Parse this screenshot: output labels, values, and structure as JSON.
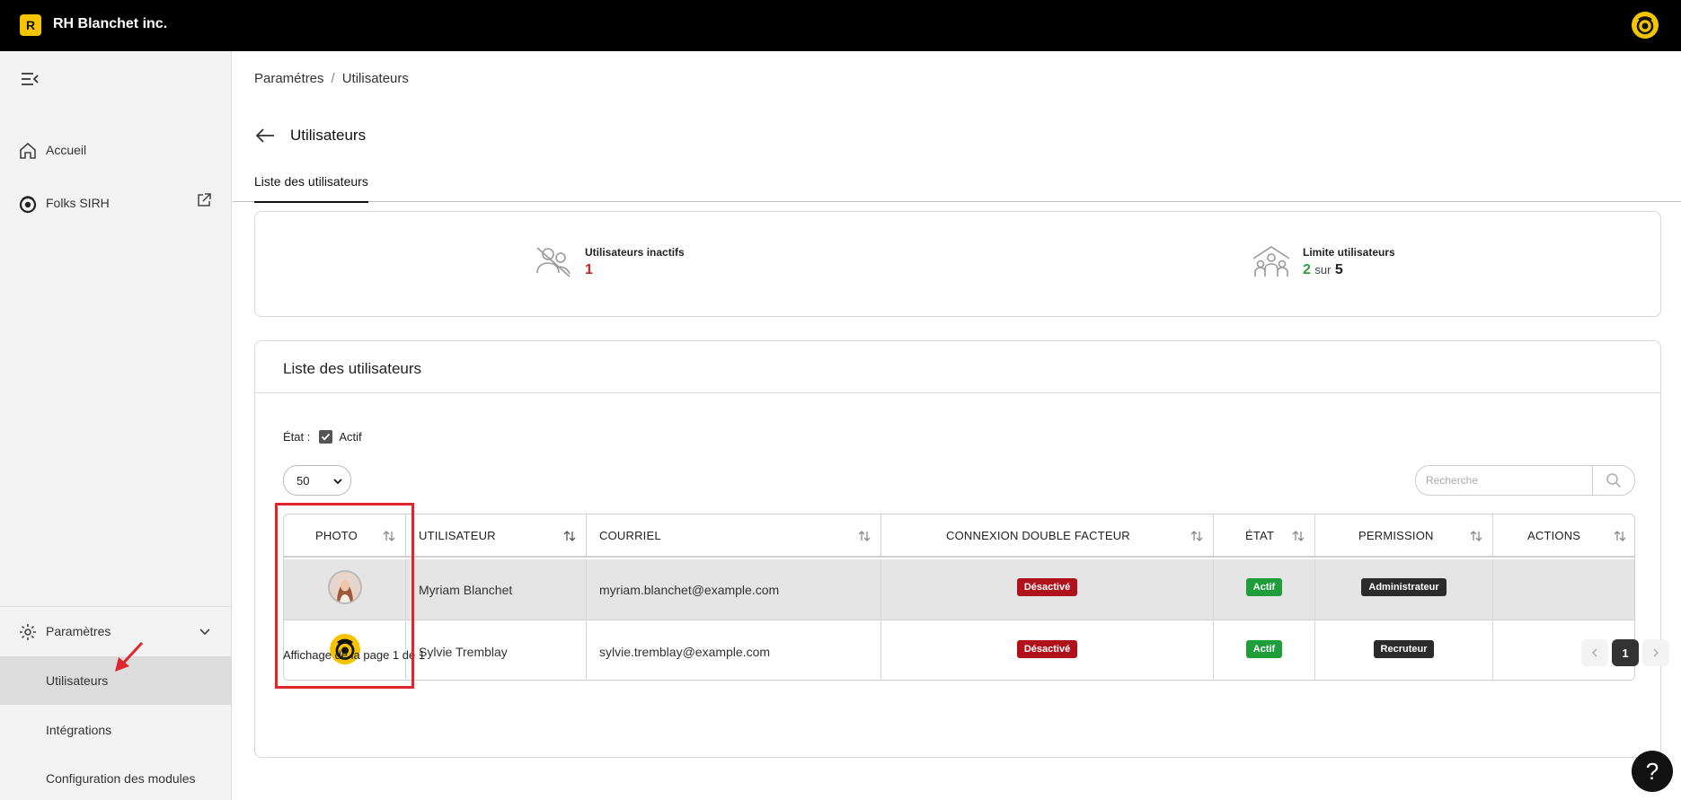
{
  "app": {
    "badge": "R",
    "name": "RH Blanchet inc."
  },
  "sidebar": {
    "items": [
      {
        "label": "Accueil",
        "icon": "home-icon"
      },
      {
        "label": "Folks SIRH",
        "icon": "folks-logo-icon"
      }
    ],
    "settings": {
      "label": "Paramètres",
      "icon": "gear-icon",
      "expanded": true
    },
    "subitems": [
      {
        "label": "Utilisateurs",
        "active": true
      },
      {
        "label": "Intégrations",
        "active": false
      },
      {
        "label": "Configuration des modules",
        "active": false
      }
    ]
  },
  "breadcrumb": {
    "parent": "Paramétres",
    "separator": "/",
    "current": "Utilisateurs"
  },
  "page": {
    "title": "Utilisateurs",
    "tab": "Liste des utilisateurs"
  },
  "stats": {
    "inactive": {
      "title": "Utilisateurs inactifs",
      "value": "1"
    },
    "limit": {
      "title": "Limite utilisateurs",
      "used": "2",
      "word": "sur",
      "max": "5"
    }
  },
  "list": {
    "title": "Liste des utilisateurs",
    "filter_label": "État :",
    "filter_option": "Actif",
    "filter_checked": true,
    "page_size": "50",
    "search_placeholder": "Recherche",
    "columns": [
      "PHOTO",
      "UTILISATEUR",
      "COURRIEL",
      "CONNEXION DOUBLE FACTEUR",
      "ÉTAT",
      "PERMISSION",
      "ACTIONS"
    ],
    "rows": [
      {
        "name": "Myriam Blanchet",
        "email": "myriam.blanchet@example.com",
        "two_factor": "Désactivé",
        "state": "Actif",
        "permission": "Administrateur"
      },
      {
        "name": "Sylvie Tremblay",
        "email": "sylvie.tremblay@example.com",
        "two_factor": "Désactivé",
        "state": "Actif",
        "permission": "Recruteur"
      }
    ],
    "page_info": "Affichage de la page 1 de 1",
    "current_page": "1"
  },
  "help": "?",
  "colors": {
    "accent": "#f5c400",
    "danger": "#b0121b",
    "success": "#1f9d3a",
    "annotation": "#e0262d"
  }
}
